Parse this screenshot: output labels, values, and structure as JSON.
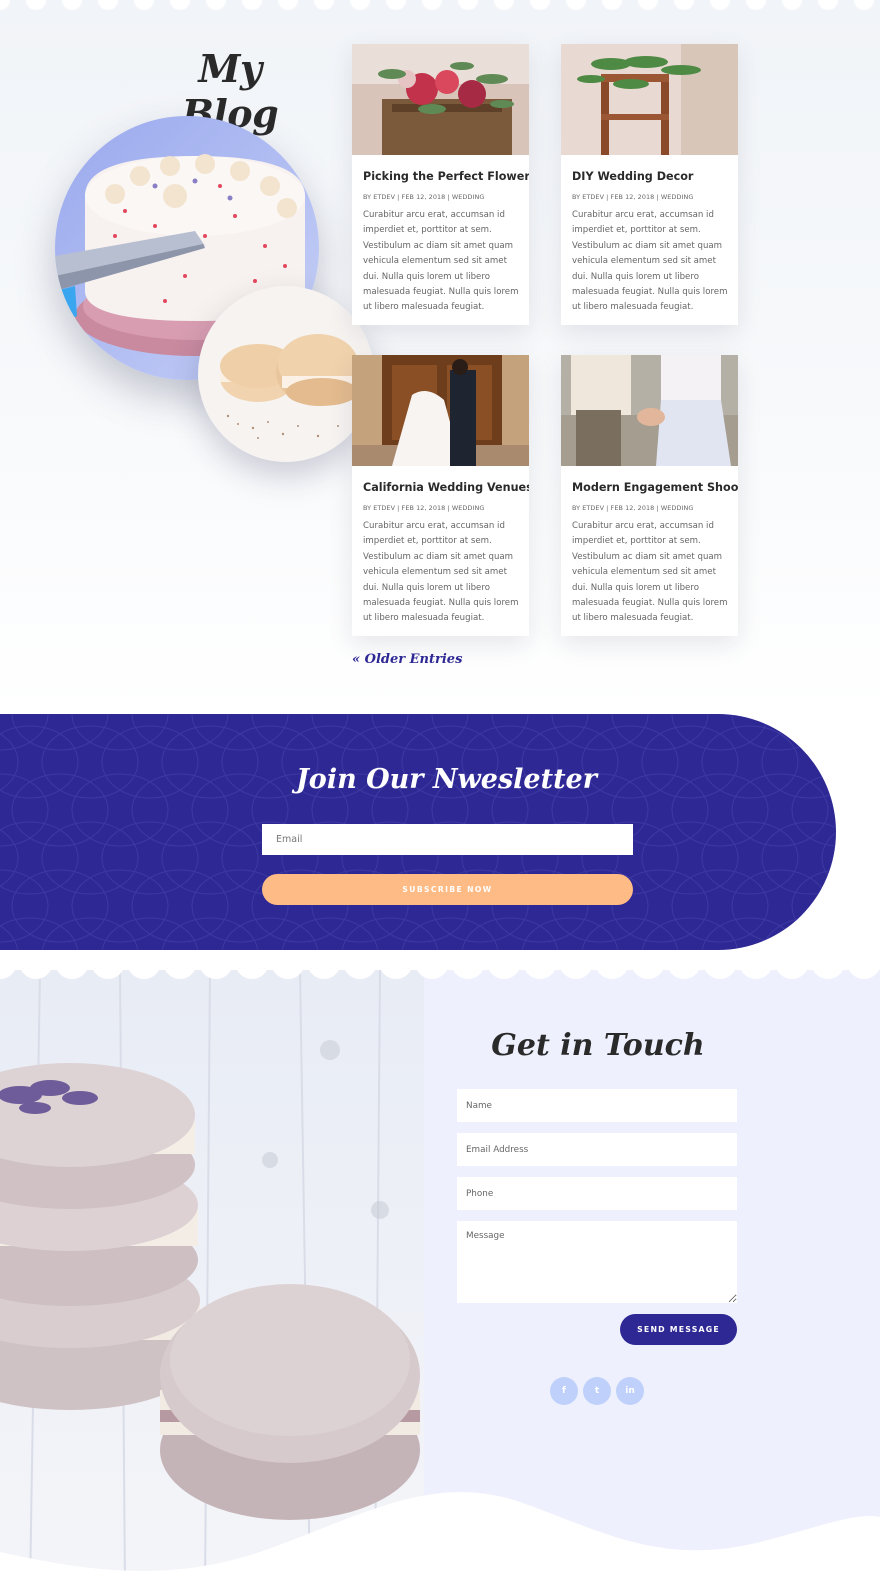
{
  "blog": {
    "title": "My Blog",
    "older_entries": "« Older Entries",
    "posts": [
      {
        "title": "Picking the Perfect Flowers",
        "meta": "BY ETDEV | FEB 12, 2018 | WEDDING",
        "excerpt": "Curabitur arcu erat, accumsan id imperdiet et, porttitor at sem. Vestibulum ac diam sit amet quam vehicula elementum sed sit amet dui. Nulla quis lorem ut libero malesuada feugiat. Nulla quis lorem ut libero malesuada feugiat."
      },
      {
        "title": "DIY Wedding Decor",
        "meta": "BY ETDEV | FEB 12, 2018 | WEDDING",
        "excerpt": "Curabitur arcu erat, accumsan id imperdiet et, porttitor at sem. Vestibulum ac diam sit amet quam vehicula elementum sed sit amet dui. Nulla quis lorem ut libero malesuada feugiat. Nulla quis lorem ut libero malesuada feugiat."
      },
      {
        "title": "California Wedding Venues",
        "meta": "BY ETDEV | FEB 12, 2018 | WEDDING",
        "excerpt": "Curabitur arcu erat, accumsan id imperdiet et, porttitor at sem. Vestibulum ac diam sit amet quam vehicula elementum sed sit amet dui. Nulla quis lorem ut libero malesuada feugiat. Nulla quis lorem ut libero malesuada feugiat."
      },
      {
        "title": "Modern Engagement Shoots",
        "meta": "BY ETDEV | FEB 12, 2018 | WEDDING",
        "excerpt": "Curabitur arcu erat, accumsan id imperdiet et, porttitor at sem. Vestibulum ac diam sit amet quam vehicula elementum sed sit amet dui. Nulla quis lorem ut libero malesuada feugiat. Nulla quis lorem ut libero malesuada feugiat."
      }
    ]
  },
  "newsletter": {
    "title": "Join Our Nwesletter",
    "email_placeholder": "Email",
    "button_label": "SUBSCRIBE NOW"
  },
  "contact": {
    "title": "Get in Touch",
    "name_placeholder": "Name",
    "email_placeholder": "Email Address",
    "phone_placeholder": "Phone",
    "message_placeholder": "Message",
    "send_label": "SEND MESSAGE",
    "social": [
      {
        "icon": "facebook-icon",
        "glyph": "f"
      },
      {
        "icon": "twitter-icon",
        "glyph": "t"
      },
      {
        "icon": "linkedin-icon",
        "glyph": "in"
      }
    ]
  },
  "colors": {
    "brand_indigo": "#2e2894",
    "accent_peach": "#ffbb85",
    "panel_lavender": "#eef1fd",
    "social_blue": "#bfd0fb"
  }
}
